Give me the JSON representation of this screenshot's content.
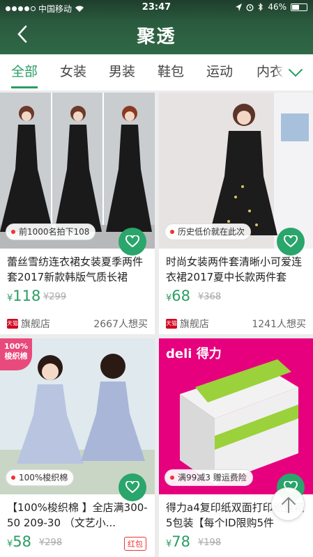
{
  "status_bar": {
    "carrier": "中国移动",
    "time": "23:47",
    "battery": "46%"
  },
  "header": {
    "title": "聚透"
  },
  "tabs": [
    "全部",
    "女装",
    "男装",
    "鞋包",
    "运动",
    "内衣"
  ],
  "products": [
    {
      "promo": "前1000名拍下108",
      "name": "蕾丝雪纺连衣裙女装夏季两件套2017新款韩版气质长裙网...",
      "currency": "¥",
      "price": "118",
      "original_price": "¥299",
      "store_badge": "天猫",
      "store": "旗舰店",
      "wants": "2667人想买"
    },
    {
      "promo": "历史低价就在此次",
      "name": "时尚女装两件套清晰小可爱连衣裙2017夏中长款两件套吊...",
      "currency": "¥",
      "price": "68",
      "original_price": "¥368",
      "store_badge": "天猫",
      "store": "旗舰店",
      "wants": "1241人想买"
    },
    {
      "corner_badge": "100%\n梭织棉",
      "promo": "100%梭织棉",
      "name": "【100%梭织棉 】全店满300-50 209-30 （文艺小...",
      "currency": "¥",
      "price": "58",
      "original_price": "¥298",
      "tag": "红包"
    },
    {
      "brand": "deli 得力",
      "promo": "满99减3 赠运费险",
      "name": "得力a4复印纸双面打印纸整箱5包装【每个ID限购5件",
      "currency": "¥",
      "price": "78",
      "original_price": "¥198"
    }
  ],
  "colors": {
    "accent": "#2a9d63",
    "header": "#2f6946"
  },
  "icons": {
    "back": "chevron-left-icon",
    "more": "chevron-down-icon",
    "fav": "heart-icon",
    "top": "arrow-up-icon"
  }
}
